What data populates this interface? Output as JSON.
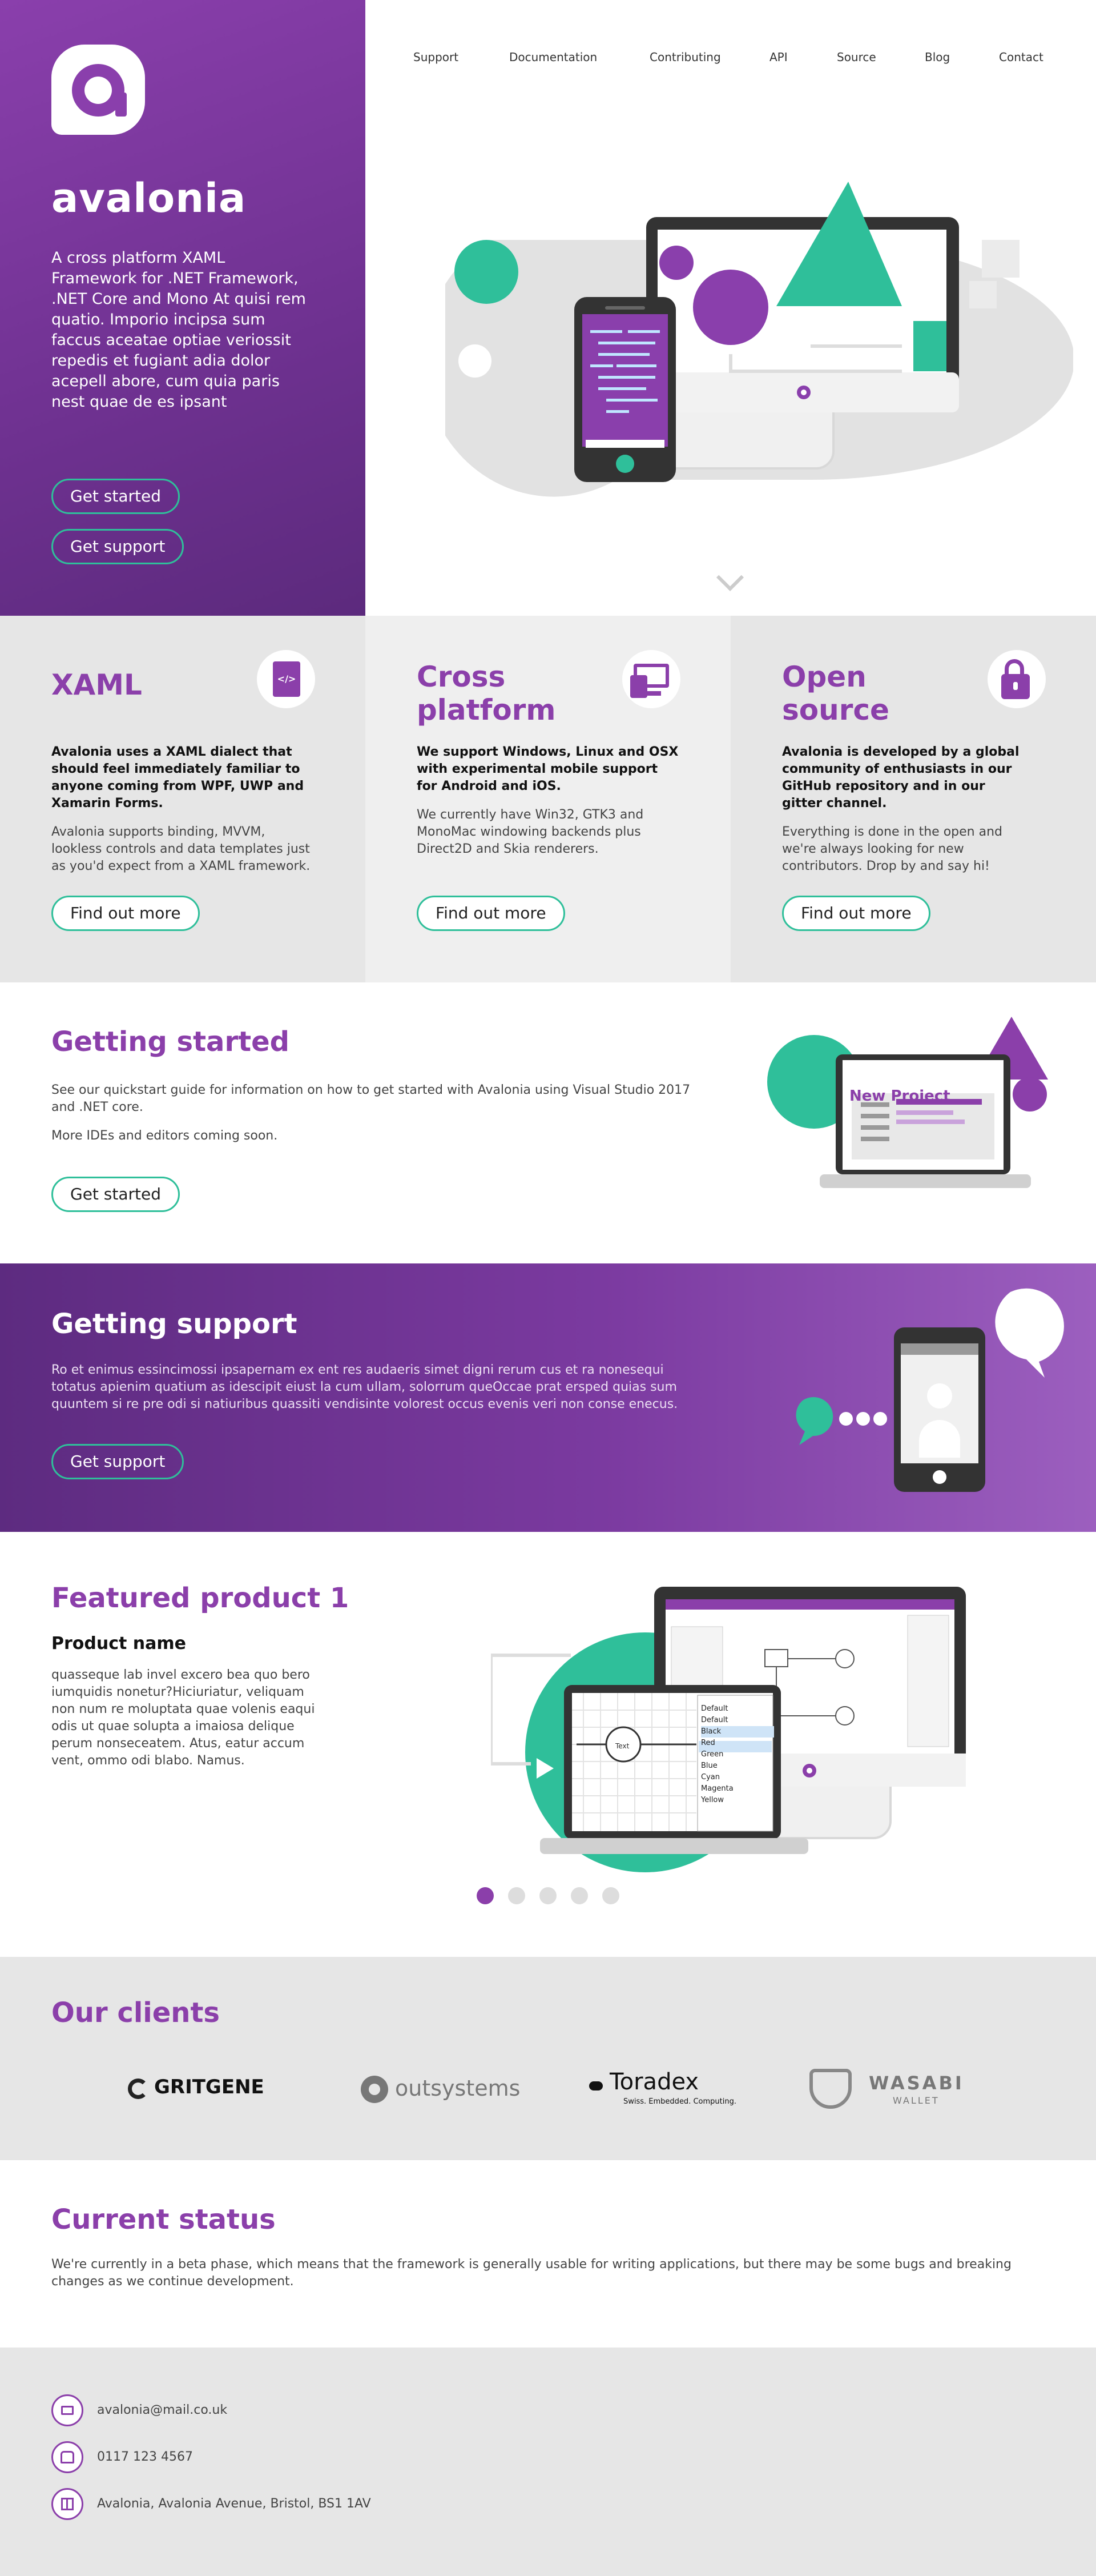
{
  "brand": {
    "name": "avalonia",
    "logo_icon": "avalonia-logo-icon"
  },
  "hero": {
    "description": "A cross platform XAML Framework for .NET Framework, .NET Core and Mono At quisi rem quatio. Imporio incipsa sum faccus aceatae optiae veriossit repedis et fugiant adia dolor acepell abore, cum quia paris nest quae de es ipsant",
    "get_started": "Get started",
    "get_support": "Get support"
  },
  "nav": {
    "items": [
      "Support",
      "Documentation",
      "Contributing",
      "API",
      "Source",
      "Blog",
      "Contact"
    ]
  },
  "features": [
    {
      "title": "XAML",
      "icon": "xaml-file-icon",
      "bold": "Avalonia uses a XAML dialect that should feel immediately familiar to anyone coming from WPF, UWP and Xamarin Forms.",
      "text": "Avalonia supports binding, MVVM, lookless controls and data templates just as you'd expect from a XAML framework.",
      "button": "Find out more"
    },
    {
      "title": "Cross platform",
      "icon": "devices-icon",
      "bold": "We support Windows, Linux and OSX with experimental mobile support for Android and iOS.",
      "text": "We currently have Win32, GTK3 and MonoMac windowing backends plus Direct2D and Skia renderers.",
      "button": "Find out more"
    },
    {
      "title": "Open source",
      "icon": "open-lock-icon",
      "bold": "Avalonia is developed by a global community of enthusiasts in our GitHub repository and in our gitter channel.",
      "text": "Everything is done in the open and we're always looking for new contributors. Drop by and say hi!",
      "button": "Find out more"
    }
  ],
  "getting_started": {
    "title": "Getting started",
    "text1": "See our quickstart guide for information on how to get started with Avalonia using Visual Studio 2017 and .NET core.",
    "text2": "More IDEs and editors coming soon.",
    "button": "Get started",
    "illustration_label": "New Project"
  },
  "getting_support": {
    "title": "Getting support",
    "text": "Ro et enimus essincimossi ipsapernam ex ent res audaeris simet digni rerum cus et ra nonesequi totatus apienim quatium as idescipit eiust la cum ullam, solorrum queOccae prat ersped quias sum quuntem si re pre odi si natiuribus quassiti vendisinte volorest occus evenis veri non conse enecus.",
    "button": "Get support"
  },
  "featured": {
    "title": "Featured product 1",
    "product_name": "Product name",
    "text": "quasseque lab invel excero bea quo bero iumquidis nonetur?Hiciuriatur, veliquam non num re moluptata quae volenis eaqui odis ut quae solupta a imaiosa delique perum nonseceatem. Atus, eatur accum vent, ommo odi blabo. Namus.",
    "carousel_count": 5,
    "carousel_active": 1,
    "screen_list": [
      "Default",
      "Default",
      "Black",
      "Red",
      "Green",
      "Blue",
      "Cyan",
      "Magenta",
      "Yellow"
    ],
    "node_label": "Text"
  },
  "clients": {
    "title": "Our clients",
    "logos": [
      {
        "name": "GRITGENE"
      },
      {
        "name": "outsystems"
      },
      {
        "name": "Toradex",
        "tagline": "Swiss. Embedded. Computing."
      },
      {
        "name": "WASABI",
        "tagline": "WALLET"
      }
    ]
  },
  "status": {
    "title": "Current status",
    "text": "We're currently in a beta phase, which means that the framework is generally usable for writing applications, but there may be some bugs and breaking changes as we continue development."
  },
  "footer": {
    "email": "avalonia@mail.co.uk",
    "phone": "0117 123 4567",
    "address": "Avalonia, Avalonia Avenue, Bristol, BS1 1AV"
  },
  "colors": {
    "purple": "#8b3faa",
    "teal": "#2fbf9a",
    "grey": "#e6e6e6",
    "dark": "#333333"
  }
}
